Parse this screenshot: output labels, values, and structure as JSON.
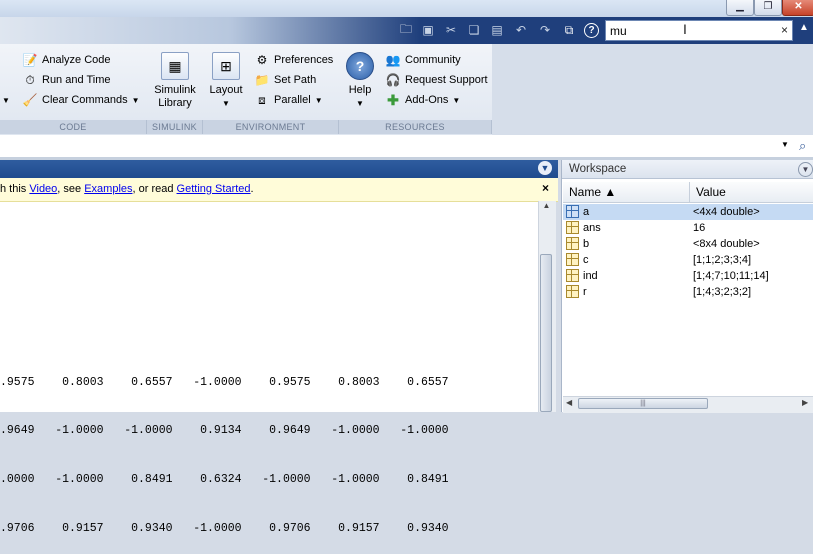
{
  "quick_access": {
    "search_value": "mu",
    "clear_label": "×",
    "icons": [
      "open-icon",
      "save-icon",
      "cut-icon",
      "copy-icon",
      "paste-icon",
      "undo-icon",
      "redo-icon",
      "switch-windows-icon",
      "help-icon"
    ]
  },
  "ribbon": {
    "code": {
      "analyze_code": "Analyze Code",
      "run_and_time": "Run and Time",
      "clear_commands": "Clear Commands",
      "footer": "CODE"
    },
    "simulink": {
      "library_line1": "Simulink",
      "library_line2": "Library",
      "footer": "SIMULINK"
    },
    "environment": {
      "layout": "Layout",
      "preferences": "Preferences",
      "set_path": "Set Path",
      "parallel": "Parallel",
      "footer": "ENVIRONMENT"
    },
    "resources": {
      "help": "Help",
      "community": "Community",
      "request_support": "Request Support",
      "add_ons": "Add-Ons",
      "footer": "RESOURCES"
    }
  },
  "command_window": {
    "notice": {
      "prefix": "h this ",
      "video": "Video",
      "mid1": ", see ",
      "examples": "Examples",
      "mid2": ", or read ",
      "getting_started": "Getting Started",
      "suffix": "."
    },
    "close_label": "×",
    "output_rows": [
      ".9575    0.8003    0.6557   -1.0000    0.9575    0.8003    0.6557",
      ".9649   -1.0000   -1.0000    0.9134    0.9649   -1.0000   -1.0000",
      ".0000   -1.0000    0.8491    0.6324   -1.0000   -1.0000    0.8491",
      ".9706    0.9157    0.9340   -1.0000    0.9706    0.9157    0.9340"
    ]
  },
  "workspace": {
    "title": "Workspace",
    "col_name": "Name ▲",
    "col_value": "Value",
    "variables": [
      {
        "name": "a",
        "value": "<4x4 double>"
      },
      {
        "name": "ans",
        "value": "16"
      },
      {
        "name": "b",
        "value": "<8x4 double>"
      },
      {
        "name": "c",
        "value": "[1;1;2;3;3;4]"
      },
      {
        "name": "ind",
        "value": "[1;4;7;10;11;14]"
      },
      {
        "name": "r",
        "value": "[1;4;3;2;3;2]"
      }
    ]
  }
}
